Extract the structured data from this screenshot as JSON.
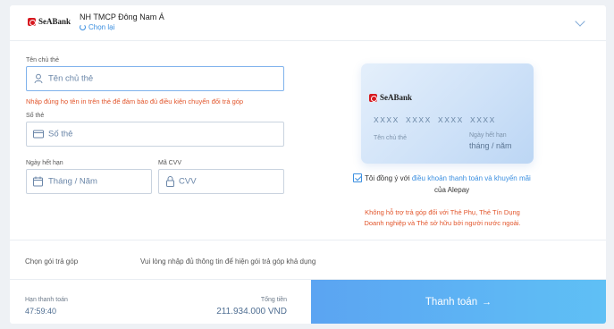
{
  "bank": {
    "logo_text": "SeABank",
    "name": "NH TMCP Đông Nam Á",
    "change_label": "Chọn lại"
  },
  "form": {
    "holder_label": "Tên chủ thẻ",
    "holder_placeholder": "Tên chủ thẻ",
    "holder_error": "Nhập đúng họ tên in trên thẻ để đảm bảo đủ điều kiện chuyển đổi trả góp",
    "number_label": "Số thẻ",
    "number_placeholder": "Số thẻ",
    "expiry_label": "Ngày hết hạn",
    "expiry_placeholder": "Tháng / Năm",
    "cvv_label": "Mã CVV",
    "cvv_placeholder": "CVV"
  },
  "card": {
    "logo_text": "SeABank",
    "number": "XXXX XXXX XXXX XXXX",
    "holder_label": "Tên chủ thẻ",
    "expiry_label": "Ngày hết hạn",
    "expiry_value": "tháng / năm"
  },
  "agreement": {
    "checked": true,
    "prefix": "Tôi đồng ý với",
    "link": "điều khoản thanh toán và khuyến mãi",
    "suffix": "của Alepay"
  },
  "notice": {
    "line1": "Không hỗ trợ trả góp đối với Thẻ Phụ, Thẻ Tín Dụng",
    "line2": "Doanh nghiệp và Thẻ sở hữu bởi người nước ngoài."
  },
  "installment": {
    "label": "Chọn gói trả góp",
    "message": "Vui lòng nhập đủ thông tin để hiện gói trả góp khả dụng"
  },
  "footer": {
    "timer_label": "Hạn thanh toán",
    "timer_value": "47:59:40",
    "total_label": "Tổng tiền",
    "total_value": "211.934.000 VND",
    "pay_label": "Thanh toán",
    "pay_arrow": "→"
  },
  "colors": {
    "accent": "#3b8fe0",
    "error": "#e2552b",
    "brand_red": "#d71920"
  }
}
